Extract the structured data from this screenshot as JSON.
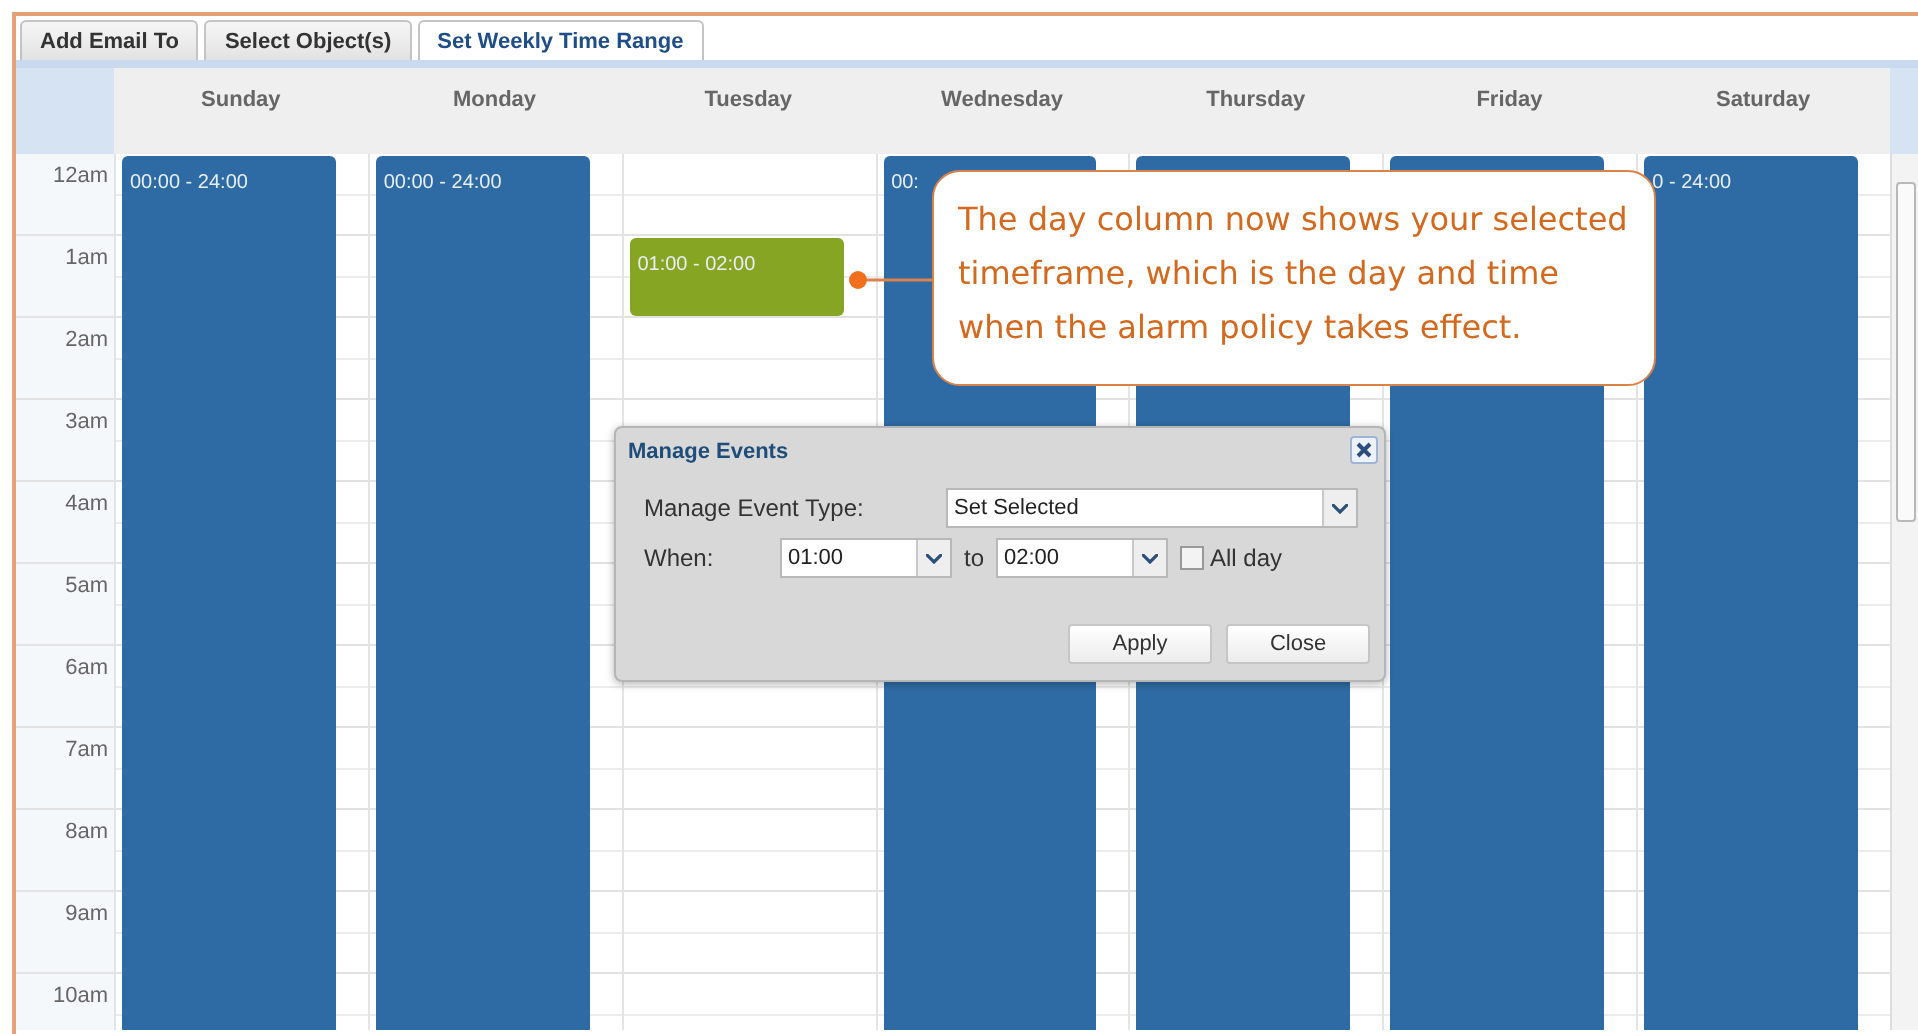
{
  "tabs": [
    {
      "label": "Add Email To",
      "selected": false
    },
    {
      "label": "Select Object(s)",
      "selected": false
    },
    {
      "label": "Set Weekly Time Range",
      "selected": true
    }
  ],
  "calendar": {
    "hours": [
      "12am",
      "1am",
      "2am",
      "3am",
      "4am",
      "5am",
      "6am",
      "7am",
      "8am",
      "9am",
      "10am"
    ],
    "days": [
      {
        "name": "Sunday",
        "events": [
          {
            "kind": "all_day",
            "label": "00:00 - 24:00",
            "color": "#2e6ba4"
          }
        ]
      },
      {
        "name": "Monday",
        "events": [
          {
            "kind": "all_day",
            "label": "00:00 - 24:00",
            "color": "#2e6ba4"
          }
        ]
      },
      {
        "name": "Tuesday",
        "events": [
          {
            "kind": "timed",
            "label": "01:00 - 02:00",
            "color": "#86a523"
          }
        ]
      },
      {
        "name": "Wednesday",
        "events": [
          {
            "kind": "all_day",
            "label": "00:",
            "color": "#2e6ba4"
          }
        ]
      },
      {
        "name": "Thursday",
        "events": [
          {
            "kind": "all_day",
            "color": "#2e6ba4"
          }
        ]
      },
      {
        "name": "Friday",
        "events": [
          {
            "kind": "all_day",
            "color": "#2e6ba4"
          }
        ]
      },
      {
        "name": "Saturday",
        "events": [
          {
            "kind": "all_day",
            "label": "0 - 24:00",
            "color": "#2e6ba4"
          }
        ]
      }
    ]
  },
  "dialog": {
    "title": "Manage Events",
    "type_label": "Manage Event Type:",
    "type_value": "Set Selected",
    "when_label": "When:",
    "from": "01:00",
    "to_label": "to",
    "to": "02:00",
    "all_day": {
      "label": "All day",
      "checked": false
    },
    "buttons": [
      "Apply",
      "Close"
    ]
  },
  "callout": {
    "text": "The day column now shows your selected timeframe, which is the day and time when the alarm policy takes effect."
  }
}
